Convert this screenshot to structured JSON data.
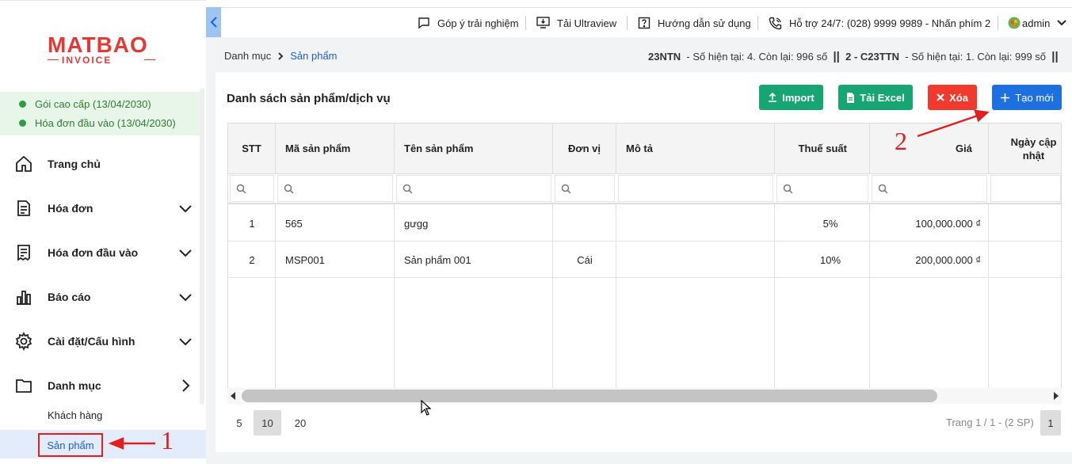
{
  "brand": {
    "name": "MATBAO",
    "sub": "INVOICE"
  },
  "packages": [
    {
      "label": "Gói cao cấp (13/04/2030)"
    },
    {
      "label": "Hóa đơn đầu vào (13/04/2030)"
    }
  ],
  "menu": [
    {
      "label": "Trang chủ",
      "icon": "home-icon"
    },
    {
      "label": "Hóa đơn",
      "icon": "invoice-icon"
    },
    {
      "label": "Hóa đơn đầu vào",
      "icon": "receipt-icon"
    },
    {
      "label": "Báo cáo",
      "icon": "bar-chart-icon"
    },
    {
      "label": "Cài đặt/Cấu hình",
      "icon": "gear-icon"
    },
    {
      "label": "Danh mục",
      "icon": "folder-icon"
    }
  ],
  "submenu": {
    "customers": "Khách hàng",
    "products": "Sản phẩm"
  },
  "topbar": {
    "feedback": "Góp ý trải nghiệm",
    "ultraview": "Tải Ultraview",
    "guide": "Hướng dẫn sử dụng",
    "support": "Hỗ trợ 24/7: (028) 9999 9989 - Nhấn phím 2",
    "user": "admin"
  },
  "breadcrumb": {
    "parent": "Danh mục",
    "current": "Sản phẩm"
  },
  "invoice_info": {
    "code1": "23NTN",
    "text1": "- Số hiện tại: 4. Còn lại: 996 số",
    "sep": "||",
    "idx2": "2",
    "code2": "C23TTN",
    "text2": "- Số hiện tại: 1. Còn lại: 999 số"
  },
  "page_title": "Danh sách sản phẩm/dịch vụ",
  "buttons": {
    "import": "Import",
    "excel": "Tải Excel",
    "delete": "Xóa",
    "create": "Tạo mới"
  },
  "colors": {
    "import": "#17a673",
    "excel": "#17a673",
    "delete": "#f03a2e",
    "create": "#1e6fe0"
  },
  "table": {
    "headers": [
      "STT",
      "Mã sản phẩm",
      "Tên sản phẩm",
      "Đơn vị",
      "Mô tả",
      "Thuế suất",
      "Giá",
      "Ngày cập nhật"
    ],
    "rows": [
      {
        "stt": "1",
        "code": "565",
        "name": "gưgg",
        "unit": "",
        "desc": "",
        "tax": "5%",
        "price": "100,000.000 ₫",
        "date": ""
      },
      {
        "stt": "2",
        "code": "MSP001",
        "name": "Sản phẩm 001",
        "unit": "Cái",
        "desc": "",
        "tax": "10%",
        "price": "200,000.000 ₫",
        "date": ""
      }
    ]
  },
  "paging": {
    "sizes": [
      "5",
      "10",
      "20"
    ],
    "selected": "10",
    "info": "Trang 1 / 1 - (2 SP)",
    "page": "1"
  },
  "annotations": {
    "one": "1",
    "two": "2"
  }
}
